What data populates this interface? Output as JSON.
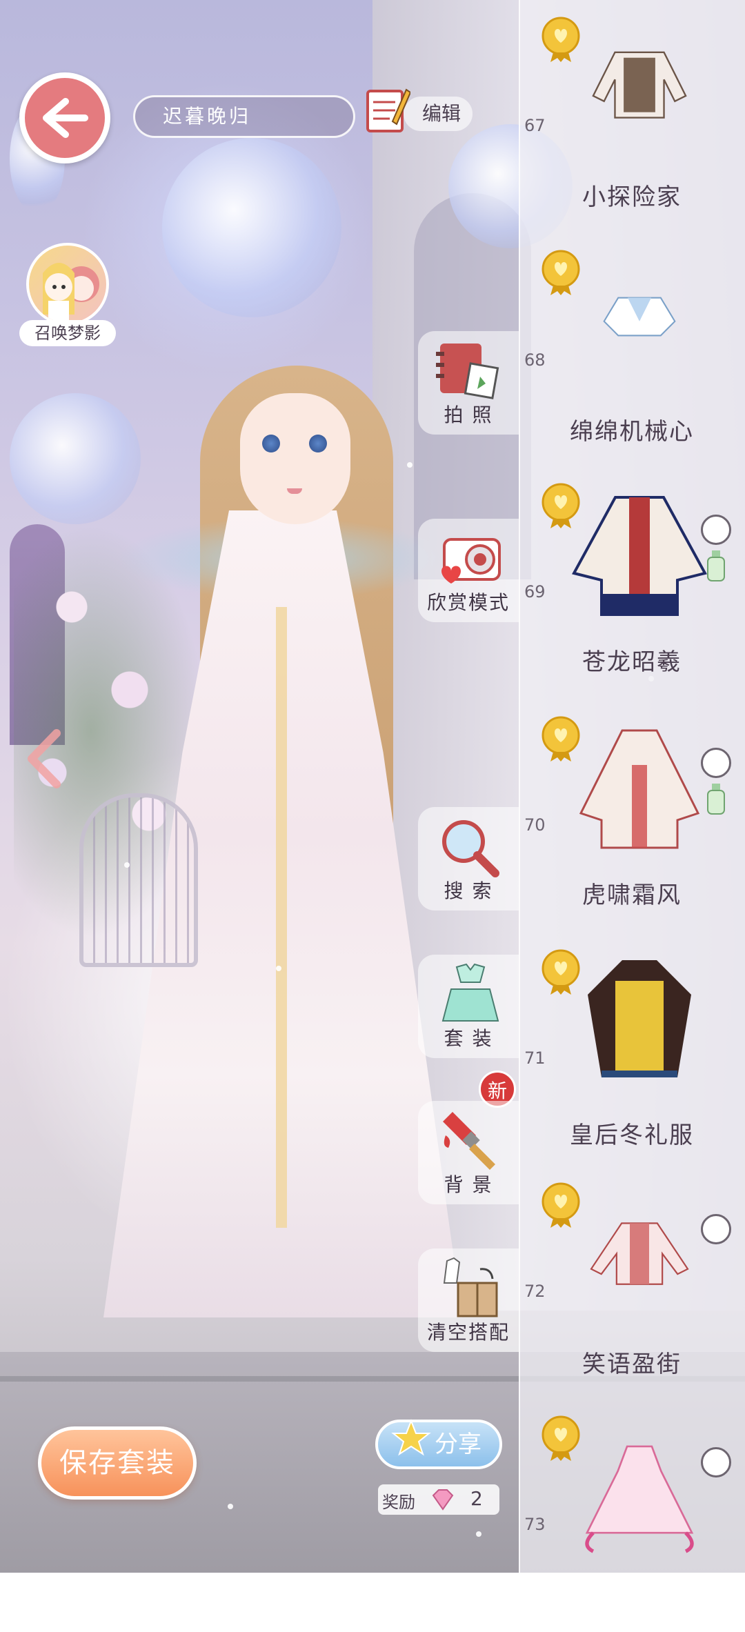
{
  "header": {
    "outfit_name": "迟暮晚归",
    "edit_label": "编辑"
  },
  "summon": {
    "label": "召唤梦影"
  },
  "menu": {
    "photo": "拍 照",
    "appreciate": "欣赏模式",
    "search": "搜 索",
    "suits": "套 装",
    "background": "背 景",
    "clear": "清空搭配",
    "new_badge": "新"
  },
  "outfits": [
    {
      "number": "67",
      "name": "小探险家",
      "pose": false
    },
    {
      "number": "68",
      "name": "绵绵机械心",
      "pose": false
    },
    {
      "number": "69",
      "name": "苍龙昭羲",
      "pose": true
    },
    {
      "number": "70",
      "name": "虎啸霜风",
      "pose": true
    },
    {
      "number": "71",
      "name": "皇后冬礼服",
      "pose": false
    },
    {
      "number": "72",
      "name": "笑语盈街",
      "pose": true
    },
    {
      "number": "73",
      "name": "",
      "pose": true
    }
  ],
  "bottom": {
    "save_label": "保存套装",
    "share_label": "分享",
    "reward_label": "奖励",
    "reward_value": "2"
  },
  "colors": {
    "accent_red": "#e47b7f",
    "save_orange": "#f7925b",
    "share_blue": "#8cc0eb",
    "medal_gold": "#f3c43a"
  }
}
